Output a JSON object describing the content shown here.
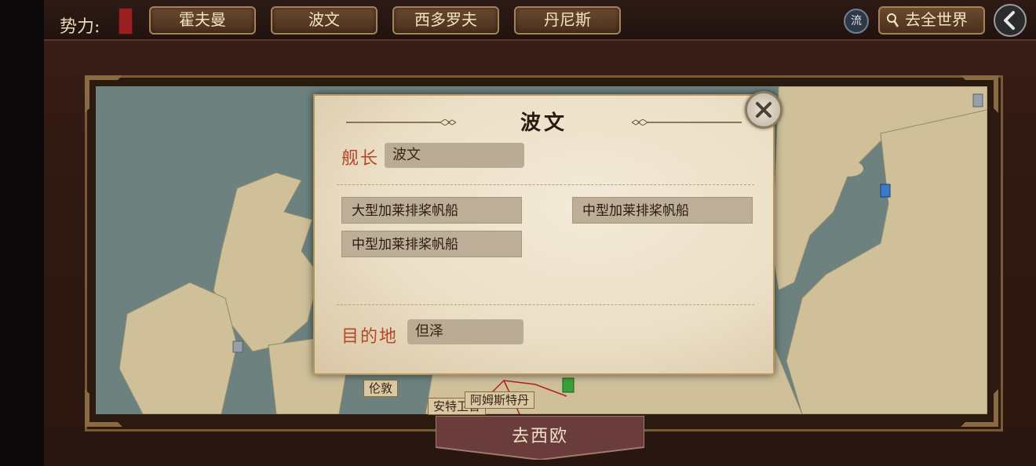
{
  "topbar": {
    "faction_label": "势力:",
    "tabs": [
      "霍夫曼",
      "波文",
      "西多罗夫",
      "丹尼斯"
    ],
    "liu_label": "流",
    "world_button_label": "去全世界"
  },
  "map": {
    "city_labels": [
      "伦敦",
      "安特卫普",
      "阿姆斯特丹"
    ],
    "bottom_tab_label": "去西欧"
  },
  "dialog": {
    "title": "波文",
    "captain_label": "舰长",
    "captain_value": "波文",
    "ships": [
      "大型加莱排桨帆船",
      "中型加莱排桨帆船",
      "中型加莱排桨帆船"
    ],
    "destination_label": "目的地",
    "destination_value": "但泽"
  },
  "colors": {
    "accent_red": "#b3482a",
    "panel_bg": "#ebdfc6",
    "tab_brown": "#4a301d"
  }
}
